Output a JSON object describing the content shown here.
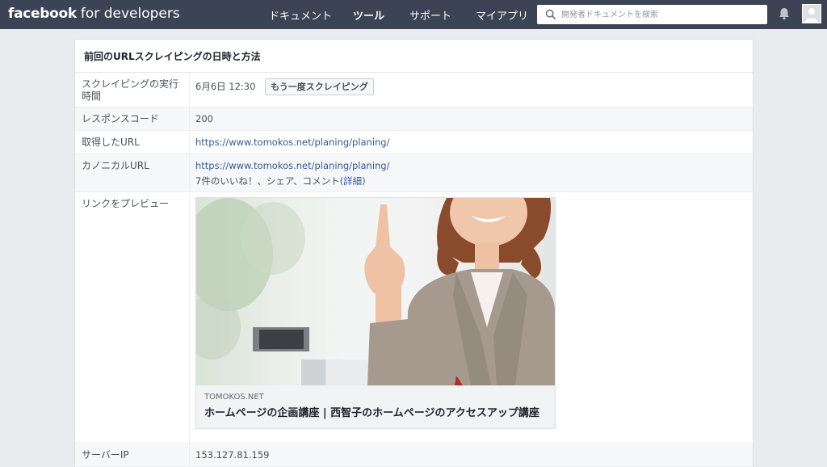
{
  "header": {
    "logo_bold": "facebook",
    "logo_rest": "for developers",
    "nav": [
      "ドキュメント",
      "ツール",
      "サポート",
      "マイアプリ"
    ],
    "search_placeholder": "開発者ドキュメントを検索"
  },
  "card": {
    "title": "前回のURLスクレイピングの日時と方法",
    "rows": {
      "scrape_time": {
        "label": "スクレイピングの実行時間",
        "value": "6月6日 12:30",
        "button": "もう一度スクレイピング"
      },
      "response_code": {
        "label": "レスポンスコード",
        "value": "200"
      },
      "fetched_url": {
        "label": "取得したURL",
        "value": "https://www.tomokos.net/planing/planing/"
      },
      "canonical_url": {
        "label": "カノニカルURL",
        "value": "https://www.tomokos.net/planing/planing/",
        "engagement": "7件のいいね！、シェア、コメント",
        "details_link": "(詳細)"
      },
      "link_preview": {
        "label": "リンクをプレビュー"
      },
      "server_ip": {
        "label": "サーバーIP",
        "value": "153.127.81.159"
      }
    },
    "preview": {
      "domain": "TOMOKOS.NET",
      "title": "ホームページの企画講座 | 西智子のホームページのアクセスアップ講座"
    }
  },
  "colors": {
    "topbar": "#3b4354",
    "link": "#365899",
    "page_bg": "#e9ebee"
  }
}
